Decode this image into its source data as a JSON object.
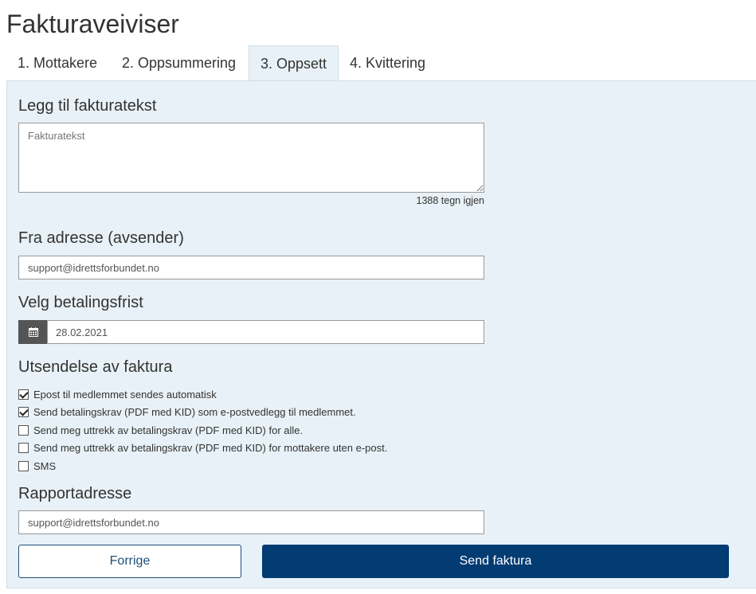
{
  "page": {
    "title": "Fakturaveiviser"
  },
  "tabs": [
    {
      "label": "1. Mottakere"
    },
    {
      "label": "2. Oppsummering"
    },
    {
      "label": "3. Oppsett",
      "active": true
    },
    {
      "label": "4. Kvittering"
    }
  ],
  "invoice_text": {
    "heading": "Legg til fakturatekst",
    "placeholder": "Fakturatekst",
    "value": "",
    "remaining": "1388 tegn igjen"
  },
  "from_address": {
    "heading": "Fra adresse (avsender)",
    "value": "support@idrettsforbundet.no"
  },
  "due_date": {
    "heading": "Velg betalingsfrist",
    "icon": "calendar-icon",
    "value": "28.02.2021"
  },
  "delivery": {
    "heading": "Utsendelse av faktura",
    "options": [
      {
        "label": "Epost til medlemmet sendes automatisk",
        "checked": true
      },
      {
        "label": "Send betalingskrav (PDF med KID) som e-postvedlegg til medlemmet.",
        "checked": true
      },
      {
        "label": "Send meg uttrekk av betalingskrav (PDF med KID) for alle.",
        "checked": false
      },
      {
        "label": "Send meg uttrekk av betalingskrav (PDF med KID) for mottakere uten e-post.",
        "checked": false
      },
      {
        "label": "SMS",
        "checked": false
      }
    ]
  },
  "report_address": {
    "heading": "Rapportadresse",
    "value": "support@idrettsforbundet.no"
  },
  "actions": {
    "previous_label": "Forrige",
    "send_label": "Send faktura"
  },
  "colors": {
    "panel_bg": "#e8f1f7",
    "primary": "#033b73",
    "calendar_button": "#555555"
  }
}
